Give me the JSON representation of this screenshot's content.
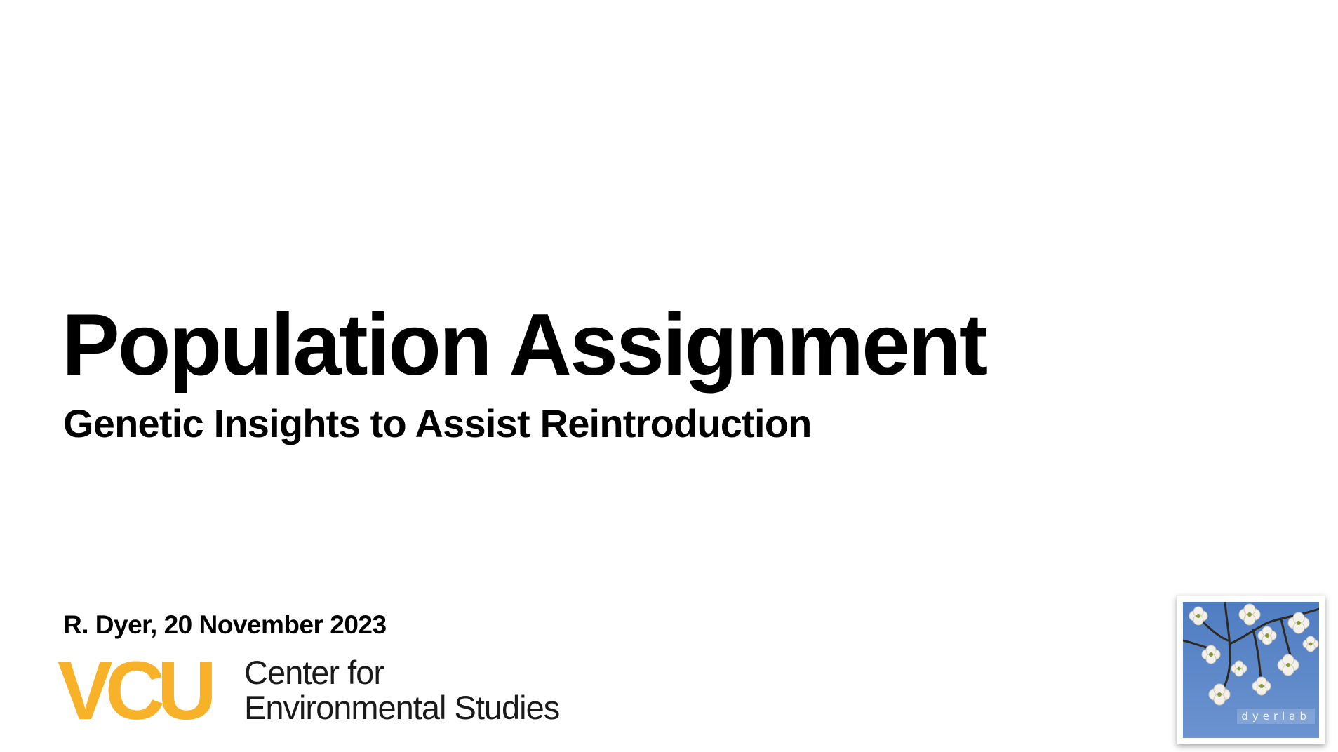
{
  "slide": {
    "title": "Population Assignment",
    "subtitle": "Genetic Insights to Assist Reintroduction",
    "author_line": "R. Dyer, 20 November 2023"
  },
  "logo": {
    "mark": "VCU",
    "line1": "Center for",
    "line2": "Environmental Studies",
    "mark_color": "#f8b229"
  },
  "badge": {
    "caption": "dyerlab",
    "image": "dogwood-flowers-on-blue-sky"
  },
  "colors": {
    "background": "#ffffff",
    "text": "#000000",
    "sky": "#5b86c6"
  }
}
